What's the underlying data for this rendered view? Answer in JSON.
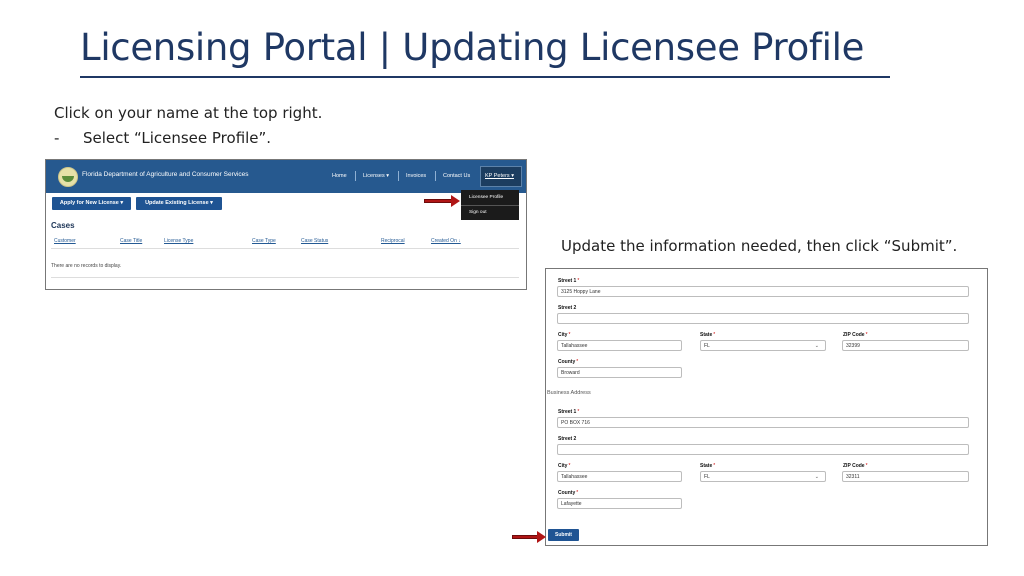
{
  "slide": {
    "title": "Licensing Portal | Updating Licensee Profile",
    "instruction_1": "Click on your name at the top right.",
    "instruction_2_bullet": "-",
    "instruction_2": "Select “Licensee Profile”.",
    "instruction_3": "Update the information needed, then click “Submit”."
  },
  "portal": {
    "agency_name": "Florida Department of Agriculture and Consumer Services",
    "nav": [
      "Home",
      "Licenses ▾",
      "Invoices",
      "Contact Us"
    ],
    "user_menu_label": "KP Peters ▾",
    "user_menu_items": [
      "Licensee Profile",
      "Sign out"
    ],
    "buttons": [
      "Apply for New License ▾",
      "Update Existing License ▾"
    ],
    "cases_heading": "Cases",
    "columns": [
      "Customer",
      "Case Title",
      "License Type",
      "Case Type",
      "Case Status",
      "Reciprocal",
      "Created On ↓"
    ],
    "empty_message": "There are no records to display."
  },
  "form": {
    "physical": {
      "street1_label": "Street 1",
      "street1_value": "3125 Hoppy Lane",
      "street2_label": "Street 2",
      "street2_value": "",
      "city_label": "City",
      "city_value": "Tallahassee",
      "state_label": "State",
      "state_value": "FL",
      "zip_label": "ZIP Code",
      "zip_value": "32399",
      "county_label": "County",
      "county_value": "Broward"
    },
    "business_section_label": "Business Address",
    "business": {
      "street1_label": "Street 1",
      "street1_value": "PO BOX 716",
      "street2_label": "Street 2",
      "street2_value": "",
      "city_label": "City",
      "city_value": "Tallahassee",
      "state_label": "State",
      "state_value": "FL",
      "zip_label": "ZIP Code",
      "zip_value": "32311",
      "county_label": "County",
      "county_value": "Lafayette"
    },
    "required_marker": "*",
    "submit_label": "Submit"
  },
  "colors": {
    "title": "#1f3864",
    "navbar": "#26598f",
    "primary_button": "#1f5493",
    "arrow": "#b01515"
  },
  "icons": [
    "fdacs-logo-icon",
    "chevron-down-icon",
    "red-arrow-icon"
  ]
}
